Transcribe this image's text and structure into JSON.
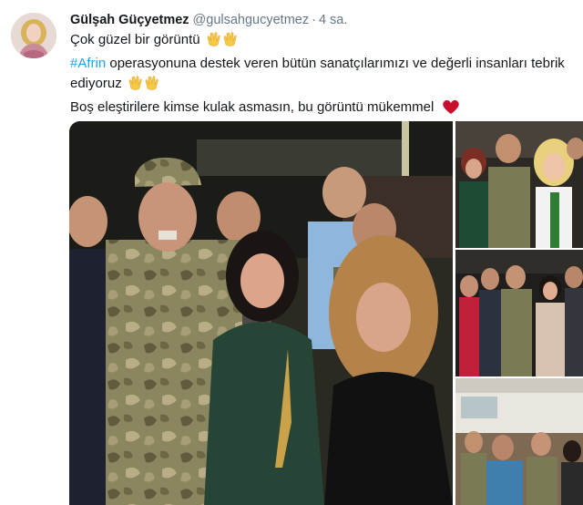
{
  "tweet": {
    "author": {
      "display_name": "Gülşah Güçyetmez",
      "handle": "@gulsahgucyetmez",
      "separator": "·",
      "timestamp": "4 sa.",
      "avatar_icon": "profile-photo"
    },
    "text": {
      "line1": "Çok güzel bir görüntü",
      "hashtag": "#Afrin",
      "line2_rest": " operasyonuna destek veren bütün sanatçılarımızı ve değerli insanları tebrik",
      "line3": "ediyoruz",
      "line4": "Boş eleştirilere kimse kulak asmasın, bu görüntü mükemmel"
    },
    "emojis": [
      "clapping-hands-icon",
      "heart-icon"
    ],
    "colors": {
      "hashtag": "#1da1f2",
      "heart": "#e0245e",
      "secondary_text": "#657786",
      "camouflage": "#7a7a55"
    },
    "media": {
      "photo_count": 4,
      "photos": [
        "main-group-photo",
        "side-photo-1",
        "side-photo-2",
        "side-photo-3"
      ]
    }
  }
}
